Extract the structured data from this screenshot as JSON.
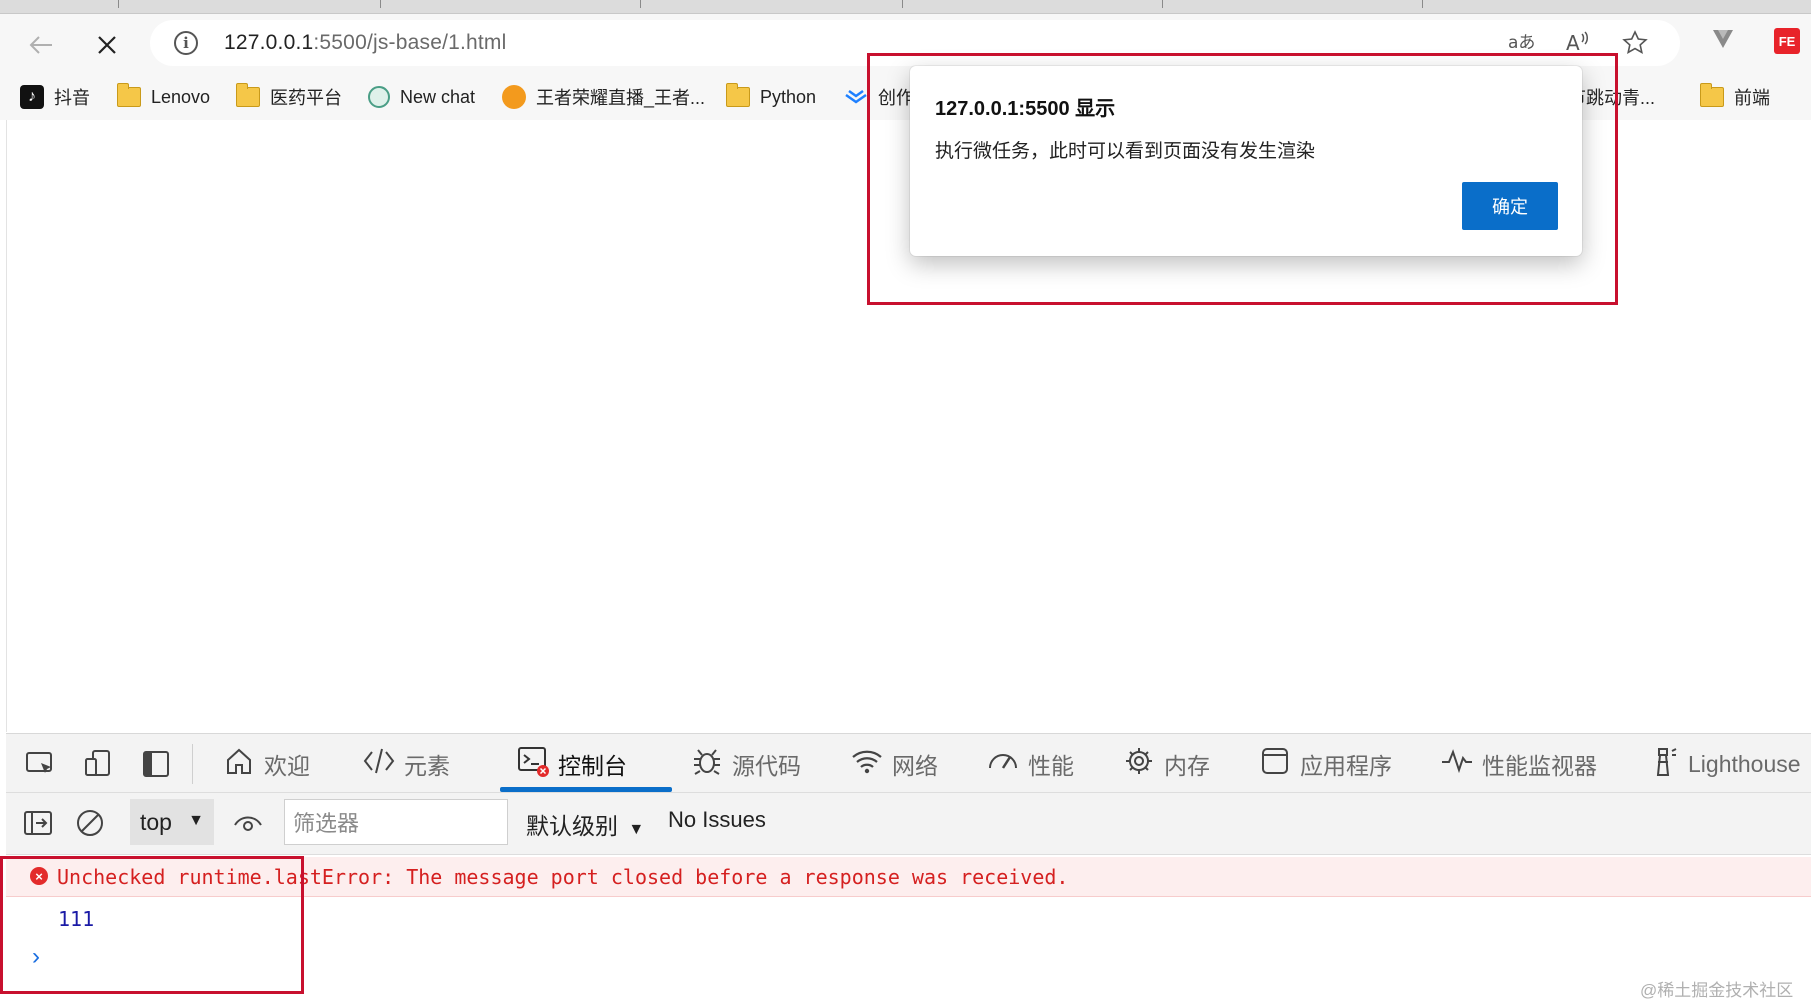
{
  "browser": {
    "url_host": "127.0.0.1",
    "url_rest": ":5500/js-base/1.html",
    "read_aloud_icon": "read-aloud-icon",
    "translate_icon": "translate-icon",
    "favorite_icon": "star-icon"
  },
  "bookmarks": [
    {
      "label": "抖音",
      "icon": "tiktok-icon"
    },
    {
      "label": "Lenovo",
      "icon": "folder-icon"
    },
    {
      "label": "医药平台",
      "icon": "folder-icon"
    },
    {
      "label": "New chat",
      "icon": "chatgpt-icon"
    },
    {
      "label": "王者荣耀直播_王者...",
      "icon": "live-icon"
    },
    {
      "label": "Python",
      "icon": "folder-icon"
    },
    {
      "label": "创作",
      "icon": "juejin-icon"
    },
    {
      "label": "字节跳动青...",
      "icon": "folder-icon"
    },
    {
      "label": "前端",
      "icon": "folder-icon"
    }
  ],
  "dialog": {
    "title": "127.0.0.1:5500 显示",
    "message": "执行微任务，此时可以看到页面没有发生渲染",
    "ok_label": "确定"
  },
  "devtools": {
    "tabs": [
      {
        "label": "欢迎"
      },
      {
        "label": "元素"
      },
      {
        "label": "控制台",
        "active": true
      },
      {
        "label": "源代码"
      },
      {
        "label": "网络"
      },
      {
        "label": "性能"
      },
      {
        "label": "内存"
      },
      {
        "label": "应用程序"
      },
      {
        "label": "性能监视器"
      },
      {
        "label": "Lighthouse"
      }
    ],
    "console_toolbar": {
      "context": "top",
      "filter_placeholder": "筛选器",
      "levels": "默认级别",
      "issues": "No Issues"
    },
    "console": {
      "error": "Unchecked runtime.lastError: The message port closed before a response was received.",
      "log": "111",
      "prompt": "›"
    }
  },
  "watermark": "@稀土掘金技术社区",
  "colors": {
    "accent": "#0a6ec9",
    "highlight": "#c8102e",
    "error_text": "#d52020",
    "error_bg": "#fdeeee"
  }
}
